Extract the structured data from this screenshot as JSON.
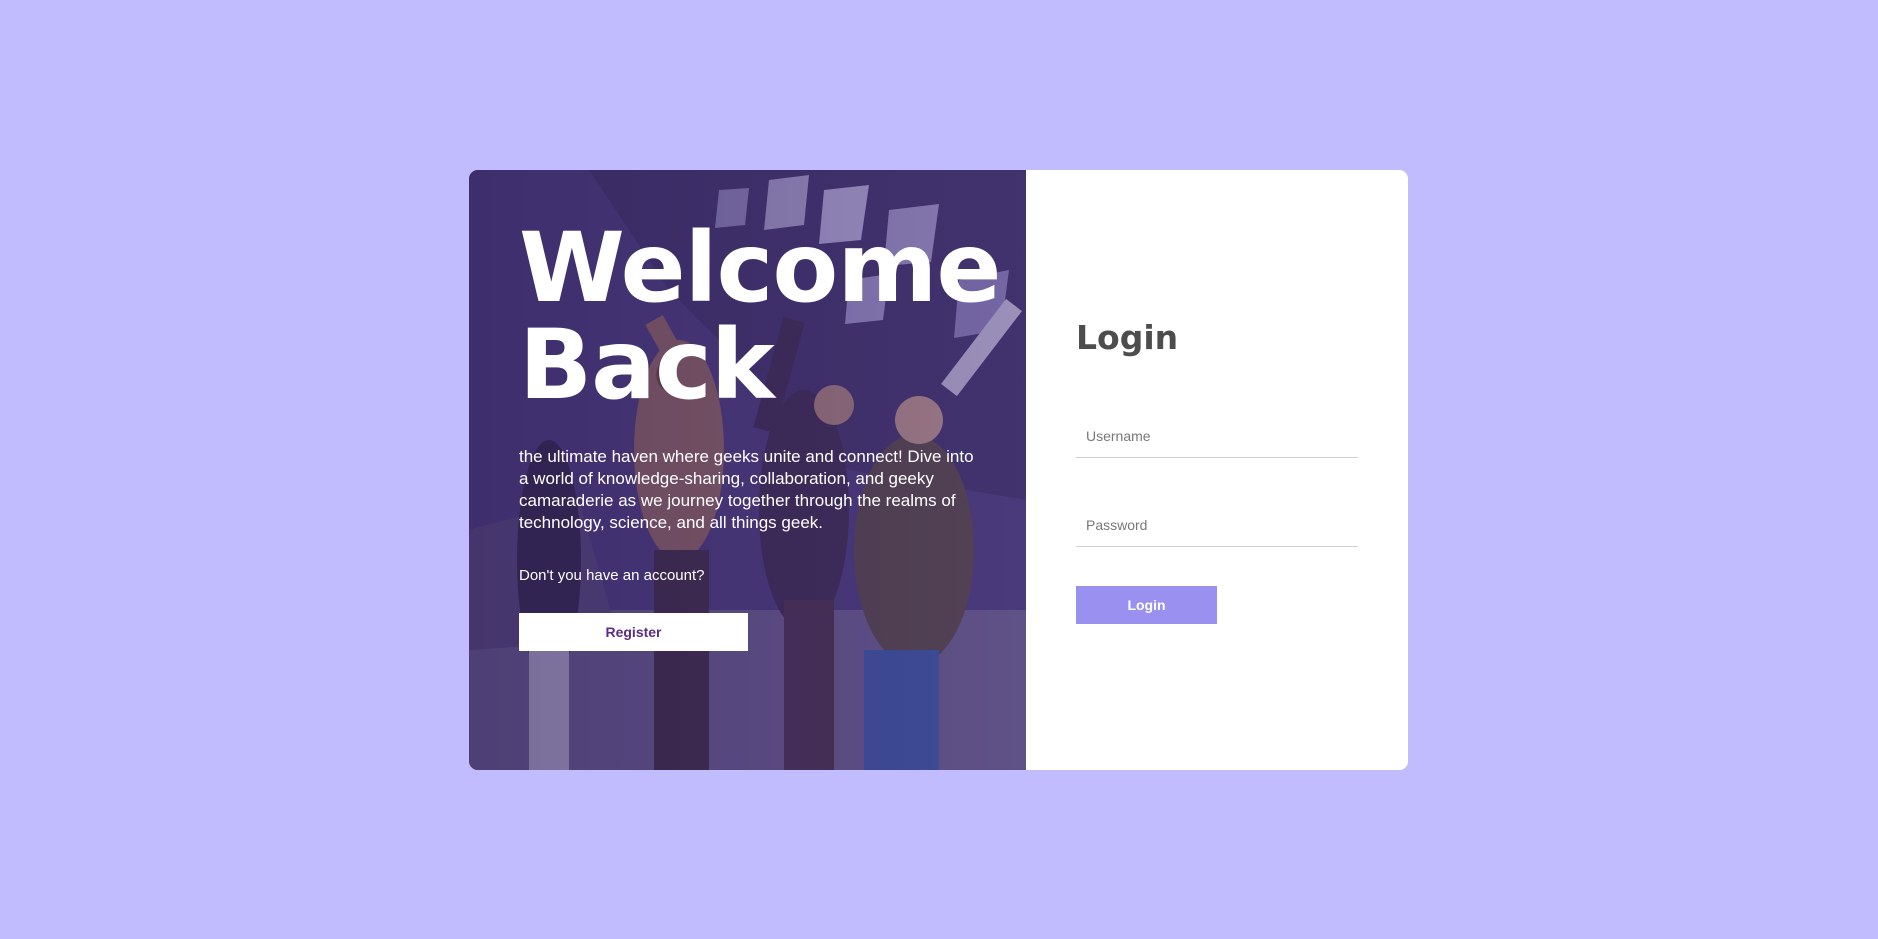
{
  "hero": {
    "title": "Welcome\nBack",
    "description": "the ultimate haven where geeks unite and connect! Dive into a world of knowledge-sharing, collaboration, and geeky camaraderie as we journey together through the realms of technology, science, and all things geek.",
    "question": "Don't you have an account?",
    "register_label": "Register"
  },
  "login": {
    "title": "Login",
    "username_placeholder": "Username",
    "password_placeholder": "Password",
    "login_label": "Login"
  },
  "colors": {
    "background": "#c1bcfd",
    "accent_button": "#9990f0",
    "register_text": "#5a2d86",
    "heading_text": "#4d4d4d"
  }
}
